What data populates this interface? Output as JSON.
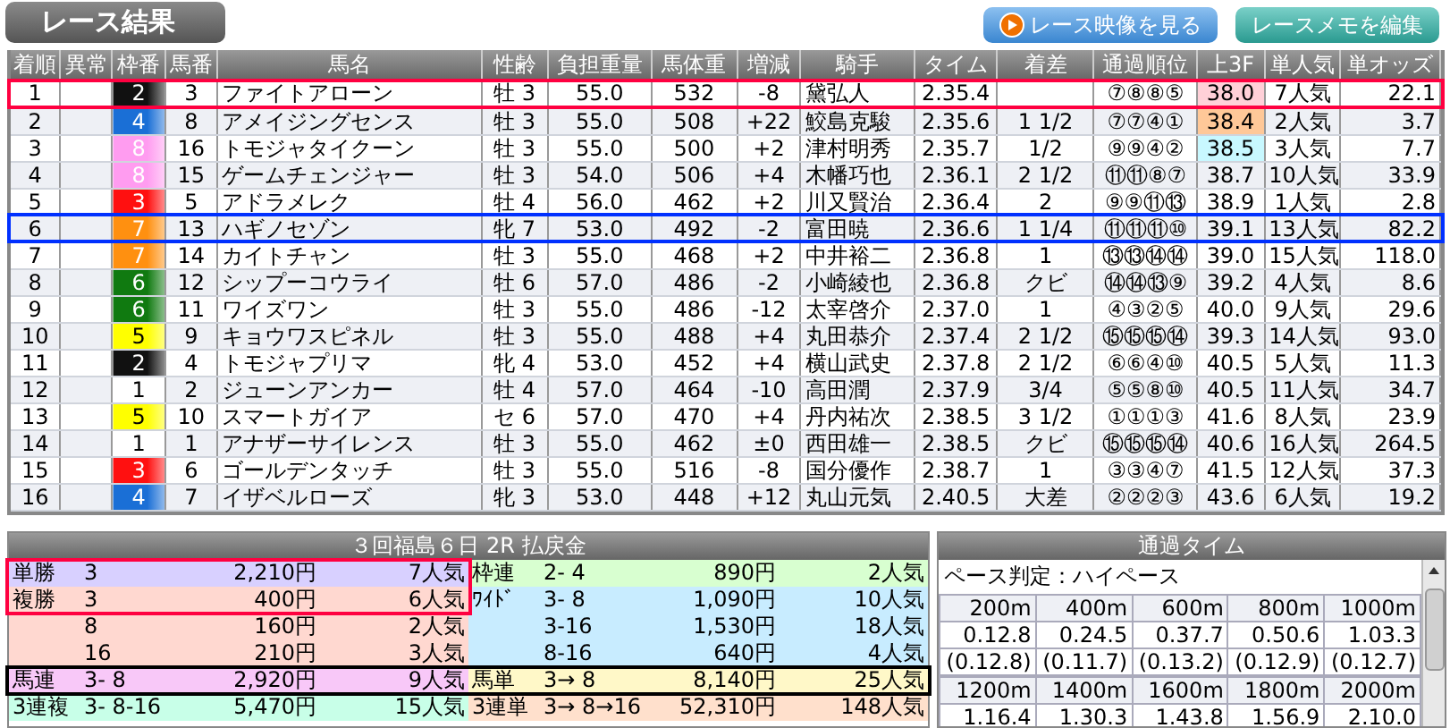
{
  "title": "レース結果",
  "buttons": [
    {
      "label": "レース映像を見る",
      "kind": "play"
    },
    {
      "label": "レースメモを編集",
      "kind": "memo"
    }
  ],
  "results": {
    "columns": [
      "着順",
      "異常",
      "枠番",
      "馬番",
      "馬名",
      "性齢",
      "負担重量",
      "馬体重",
      "増減",
      "騎手",
      "タイム",
      "着差",
      "通過順位",
      "上3F",
      "単人気",
      "単オッズ"
    ],
    "rows": [
      {
        "cells": [
          "1",
          "",
          "2",
          "3",
          "ファイトアローン",
          "牡 3",
          "55.0",
          "532",
          "-8",
          "黛弘人",
          "2.35.4",
          "",
          "⑦⑧⑧⑤",
          "38.0",
          "7人気",
          "22.1"
        ],
        "color": "#111111",
        "last3f": {
          "color": "#ffd0d8"
        },
        "highlight": {
          "color": "#ff0040"
        }
      },
      {
        "cells": [
          "2",
          "",
          "4",
          "8",
          "アメイジングセンス",
          "牡 3",
          "55.0",
          "508",
          "+22",
          "鮫島克駿",
          "2.35.6",
          "1 1/2",
          "⑦⑦④①",
          "38.4",
          "2人気",
          "3.7"
        ],
        "color": "#1a6fd6",
        "last3f": {
          "color": "#ffc898"
        }
      },
      {
        "cells": [
          "3",
          "",
          "8",
          "16",
          "トモジャタイクーン",
          "牡 3",
          "55.0",
          "500",
          "+2",
          "津村明秀",
          "2.35.7",
          "1/2",
          "⑨⑨④②",
          "38.5",
          "3人気",
          "7.7"
        ],
        "color": "#ff9cf0",
        "last3f": {
          "color": "#c8f8ff"
        }
      },
      {
        "cells": [
          "4",
          "",
          "8",
          "15",
          "ゲームチェンジャー",
          "牡 3",
          "54.0",
          "506",
          "+4",
          "木幡巧也",
          "2.36.1",
          "2 1/2",
          "⑪⑪⑧⑦",
          "38.7",
          "10人気",
          "33.9"
        ],
        "color": "#ff9cf0"
      },
      {
        "cells": [
          "5",
          "",
          "3",
          "5",
          "アドラメレク",
          "牡 4",
          "56.0",
          "462",
          "+2",
          "川又賢治",
          "2.36.4",
          "2",
          "⑨⑨⑪⑬",
          "38.9",
          "1人気",
          "2.8"
        ],
        "color": "#ff1010"
      },
      {
        "cells": [
          "6",
          "",
          "7",
          "13",
          "ハギノセゾン",
          "牝 7",
          "53.0",
          "492",
          "-2",
          "富田暁",
          "2.36.6",
          "1 1/4",
          "⑪⑪⑪⑩",
          "39.1",
          "13人気",
          "82.2"
        ],
        "color": "#ff9010",
        "highlight": {
          "color": "#0030ff"
        }
      },
      {
        "cells": [
          "7",
          "",
          "7",
          "14",
          "カイトチャン",
          "牡 3",
          "55.0",
          "468",
          "+2",
          "中井裕二",
          "2.36.8",
          "1",
          "⑬⑬⑭⑭",
          "39.0",
          "15人気",
          "118.0"
        ],
        "color": "#ff9010"
      },
      {
        "cells": [
          "8",
          "",
          "6",
          "12",
          "シップーコウライ",
          "牡 6",
          "57.0",
          "486",
          "-2",
          "小崎綾也",
          "2.36.8",
          "クビ",
          "⑭⑭⑬⑨",
          "39.2",
          "4人気",
          "8.6"
        ],
        "color": "#107a10"
      },
      {
        "cells": [
          "9",
          "",
          "6",
          "11",
          "ワイズワン",
          "牡 3",
          "55.0",
          "486",
          "-12",
          "太宰啓介",
          "2.37.0",
          "1",
          "④③②⑤",
          "40.0",
          "9人気",
          "29.6"
        ],
        "color": "#107a10"
      },
      {
        "cells": [
          "10",
          "",
          "5",
          "9",
          "キョウワスピネル",
          "牡 3",
          "55.0",
          "488",
          "+4",
          "丸田恭介",
          "2.37.4",
          "2 1/2",
          "⑮⑮⑮⑭",
          "39.3",
          "14人気",
          "93.0"
        ],
        "color": "#ffff00"
      },
      {
        "cells": [
          "11",
          "",
          "2",
          "4",
          "トモジャプリマ",
          "牝 4",
          "53.0",
          "452",
          "+4",
          "横山武史",
          "2.37.8",
          "2 1/2",
          "⑥⑥④⑩",
          "40.5",
          "5人気",
          "11.3"
        ],
        "color": "#111111"
      },
      {
        "cells": [
          "12",
          "",
          "1",
          "2",
          "ジューンアンカー",
          "牡 4",
          "57.0",
          "464",
          "-10",
          "高田潤",
          "2.37.9",
          "3/4",
          "⑤⑤⑧⑩",
          "40.5",
          "11人気",
          "34.7"
        ],
        "color": "#ffffff"
      },
      {
        "cells": [
          "13",
          "",
          "5",
          "10",
          "スマートガイア",
          "セ 6",
          "57.0",
          "470",
          "+4",
          "丹内祐次",
          "2.38.5",
          "3 1/2",
          "①①①③",
          "41.6",
          "8人気",
          "23.9"
        ],
        "color": "#ffff00"
      },
      {
        "cells": [
          "14",
          "",
          "1",
          "1",
          "アナザーサイレンス",
          "牡 3",
          "55.0",
          "462",
          "±0",
          "西田雄一",
          "2.38.5",
          "クビ",
          "⑮⑮⑮⑭",
          "40.6",
          "16人気",
          "264.5"
        ],
        "color": "#ffffff"
      },
      {
        "cells": [
          "15",
          "",
          "3",
          "6",
          "ゴールデンタッチ",
          "牡 3",
          "55.0",
          "516",
          "-8",
          "国分優作",
          "2.38.7",
          "1",
          "③③④⑦",
          "41.5",
          "12人気",
          "37.3"
        ],
        "color": "#ff1010"
      },
      {
        "cells": [
          "16",
          "",
          "4",
          "7",
          "イザベルローズ",
          "牝 3",
          "53.0",
          "448",
          "+12",
          "丸山元気",
          "2.40.5",
          "大差",
          "②②②③",
          "43.6",
          "6人気",
          "19.2"
        ],
        "color": "#1a6fd6"
      }
    ]
  },
  "payouts": {
    "title": "３回福島６日 2R 払戻金",
    "left": [
      {
        "bet": "単勝",
        "numbers": "3",
        "amount": "2,210円",
        "popularity": "7人気",
        "color": "#d8d0ff",
        "frame": {
          "color": "#ff0040"
        }
      },
      {
        "bet": "複勝",
        "numbers": "3",
        "amount": "400円",
        "popularity": "6人気",
        "color": "#ffd8d0",
        "frame": {
          "color": "#ff0040"
        }
      },
      {
        "numbers": "8",
        "amount": "160円",
        "popularity": "2人気",
        "color": "#ffd8d0"
      },
      {
        "numbers": "16",
        "amount": "210円",
        "popularity": "3人気",
        "color": "#ffd8d0"
      },
      {
        "bet": "馬連",
        "numbers": "3- 8",
        "amount": "2,920円",
        "popularity": "9人気",
        "color": "#f8c8f8",
        "frame": {
          "color": "#000000"
        }
      },
      {
        "bet": "3連複",
        "numbers": "3- 8-16",
        "amount": "5,470円",
        "popularity": "15人気",
        "color": "#c8ffe8"
      }
    ],
    "right": [
      {
        "bet": "枠連",
        "numbers": "2- 4",
        "amount": "890円",
        "popularity": "2人気",
        "color": "#d8ffd0"
      },
      {
        "bet": "ﾜｲﾄﾞ",
        "numbers": "3- 8",
        "amount": "1,090円",
        "popularity": "10人気",
        "color": "#c8ecff"
      },
      {
        "numbers": "3-16",
        "amount": "1,530円",
        "popularity": "18人気",
        "color": "#c8ecff"
      },
      {
        "numbers": "8-16",
        "amount": "640円",
        "popularity": "4人気",
        "color": "#c8ecff"
      },
      {
        "bet": "馬単",
        "numbers": "3→ 8",
        "amount": "8,140円",
        "popularity": "25人気",
        "color": "#fff8c8",
        "frame": {
          "color": "#000000"
        }
      },
      {
        "bet": "3連単",
        "numbers": "3→ 8→16",
        "amount": "52,310円",
        "popularity": "148人気",
        "color": "#ffe0cc"
      }
    ]
  },
  "passing_times": {
    "title": "通過タイム",
    "pace": "ペース判定：ハイペース",
    "blocks": [
      {
        "distances": [
          "200m",
          "400m",
          "600m",
          "800m",
          "1000m"
        ],
        "times": [
          "0.12.8",
          "0.24.5",
          "0.37.7",
          "0.50.6",
          "1.03.3"
        ],
        "splits": [
          "(0.12.8)",
          "(0.11.7)",
          "(0.13.2)",
          "(0.12.9)",
          "(0.12.7)"
        ]
      },
      {
        "distances": [
          "1200m",
          "1400m",
          "1600m",
          "1800m",
          "2000m"
        ],
        "times": [
          "1.16.4",
          "1.30.3",
          "1.43.8",
          "1.56.9",
          "2.10.0"
        ]
      }
    ]
  }
}
